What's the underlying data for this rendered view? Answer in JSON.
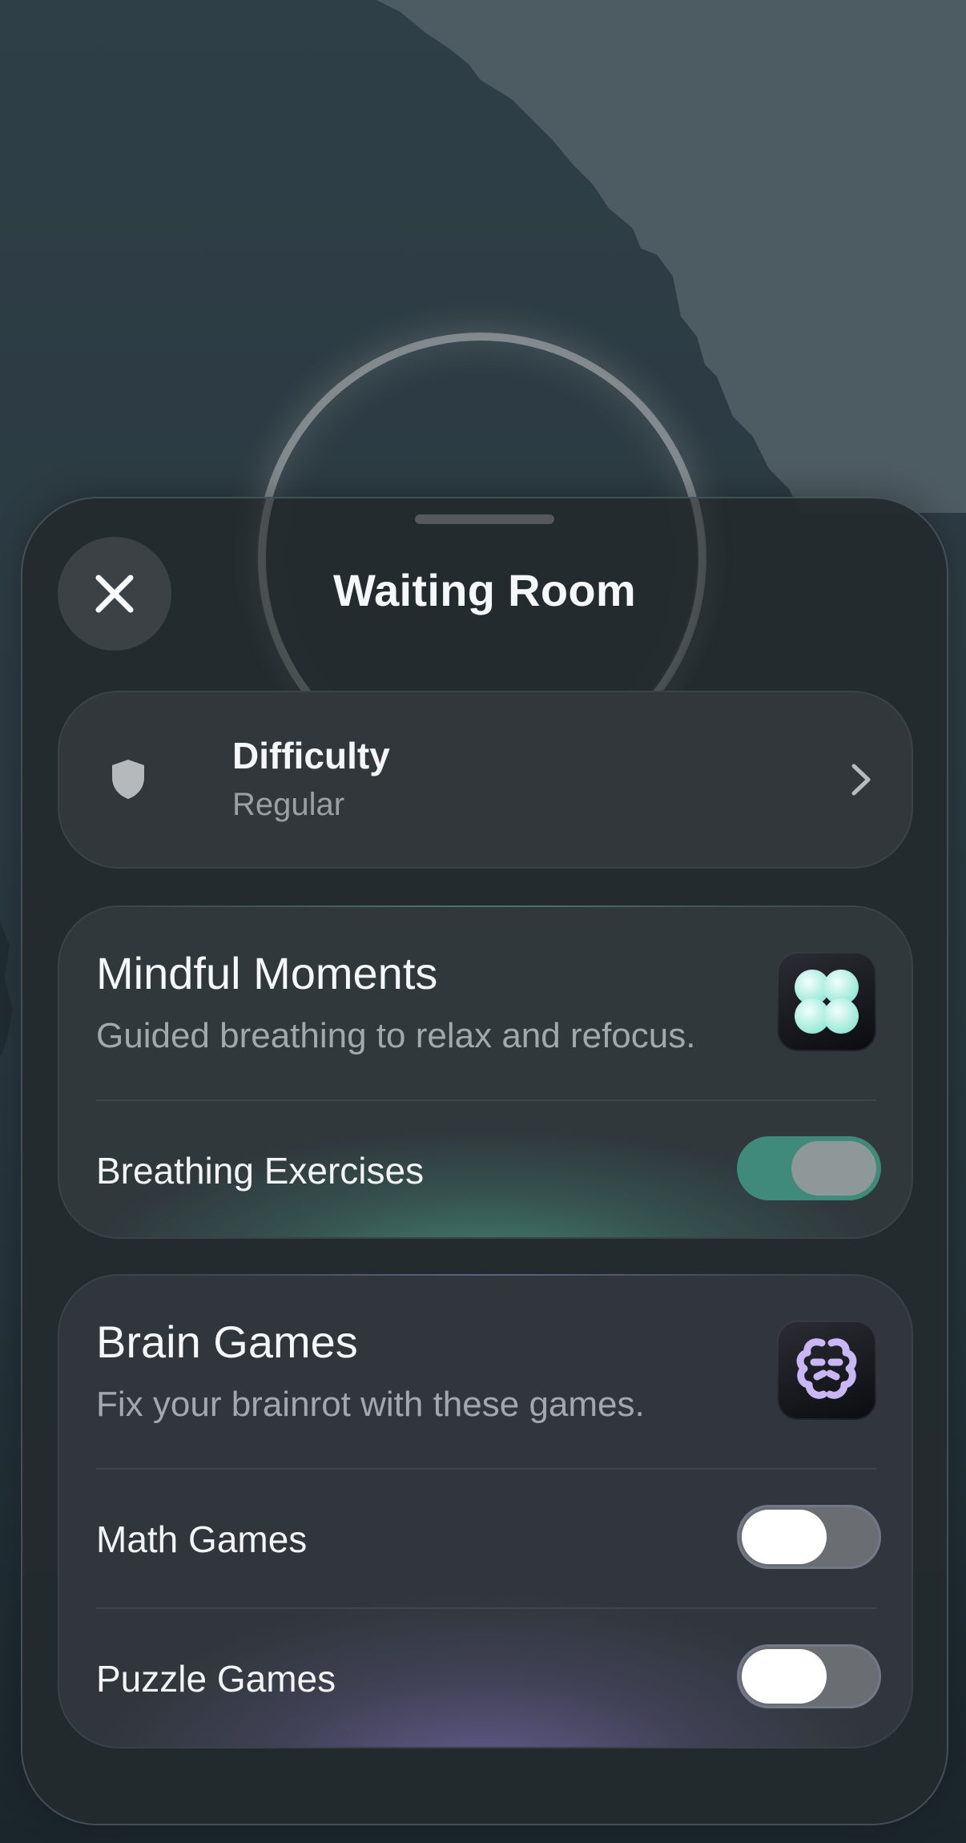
{
  "header": {
    "title": "Waiting Room",
    "close_icon": "close-icon"
  },
  "difficulty": {
    "label": "Difficulty",
    "value": "Regular",
    "icon": "shield-icon",
    "chevron": "chevron-right-icon"
  },
  "mindful": {
    "title": "Mindful Moments",
    "subtitle": "Guided breathing to relax and refocus.",
    "icon": "breathing-app-icon",
    "toggle_label": "Breathing Exercises",
    "toggle_on": true,
    "accent_color": "#3f8a78"
  },
  "brain": {
    "title": "Brain Games",
    "subtitle": "Fix your brainrot with these games.",
    "icon": "brain-app-icon",
    "rows": [
      {
        "label": "Math Games",
        "on": false
      },
      {
        "label": "Puzzle Games",
        "on": false
      }
    ],
    "accent_color": "#7a70b0"
  }
}
